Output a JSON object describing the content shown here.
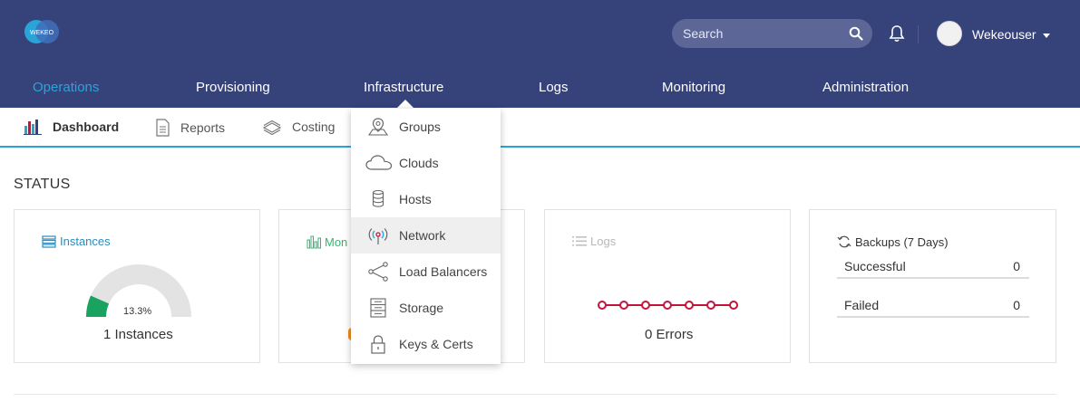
{
  "header": {
    "logo_text": "WEKEO",
    "search_placeholder": "Search",
    "username": "Wekeouser"
  },
  "main_nav": [
    "Operations",
    "Provisioning",
    "Infrastructure",
    "Logs",
    "Monitoring",
    "Administration"
  ],
  "sub_nav": [
    "Dashboard",
    "Reports",
    "Costing"
  ],
  "status_title": "STATUS",
  "cards": {
    "instances": {
      "title": "Instances",
      "gauge_percent": "13.3%",
      "gauge_fraction": 0.133,
      "footer": "1 Instances"
    },
    "monitoring": {
      "title": "Mon"
    },
    "logs": {
      "title": "Logs",
      "footer": "0 Errors"
    },
    "backups": {
      "title": "Backups (7 Days)",
      "rows": [
        {
          "label": "Successful",
          "value": "0"
        },
        {
          "label": "Failed",
          "value": "0"
        }
      ]
    }
  },
  "infrastructure_menu": [
    {
      "label": "Groups",
      "icon": "location-pin-icon"
    },
    {
      "label": "Clouds",
      "icon": "cloud-icon"
    },
    {
      "label": "Hosts",
      "icon": "database-icon"
    },
    {
      "label": "Network",
      "icon": "wireless-icon"
    },
    {
      "label": "Load Balancers",
      "icon": "share-icon"
    },
    {
      "label": "Storage",
      "icon": "server-icon"
    },
    {
      "label": "Keys & Certs",
      "icon": "lock-icon"
    }
  ],
  "colors": {
    "header_bg": "#36427a",
    "accent_blue": "#2aa4d8",
    "gauge_green": "#1aa260",
    "logs_red": "#c0143c",
    "monitor_green": "#2dbb70"
  }
}
